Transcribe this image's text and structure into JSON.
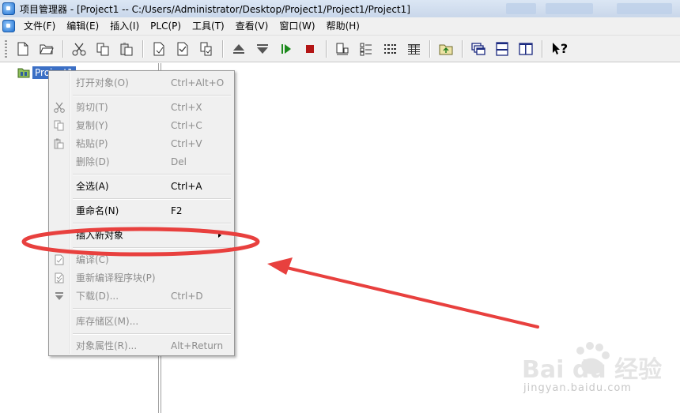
{
  "window": {
    "title": "项目管理器 - [Project1 -- C:/Users/Administrator/Desktop/Project1/Project1/Project1]"
  },
  "menubar": {
    "items": [
      "文件(F)",
      "编辑(E)",
      "插入(I)",
      "PLC(P)",
      "工具(T)",
      "查看(V)",
      "窗口(W)",
      "帮助(H)"
    ]
  },
  "toolbar": {
    "help_label": "?"
  },
  "tree": {
    "root_label": "Project1"
  },
  "context_menu": {
    "items": [
      {
        "label": "打开对象(O)",
        "shortcut": "Ctrl+Alt+O",
        "enabled": false
      },
      {
        "label": "剪切(T)",
        "shortcut": "Ctrl+X",
        "enabled": false,
        "icon": "scissors-icon"
      },
      {
        "label": "复制(Y)",
        "shortcut": "Ctrl+C",
        "enabled": false,
        "icon": "copy-icon"
      },
      {
        "label": "粘贴(P)",
        "shortcut": "Ctrl+V",
        "enabled": false,
        "icon": "paste-icon"
      },
      {
        "label": "删除(D)",
        "shortcut": "Del",
        "enabled": false
      },
      {
        "label": "全选(A)",
        "shortcut": "Ctrl+A",
        "enabled": true
      },
      {
        "label": "重命名(N)",
        "shortcut": "F2",
        "enabled": true
      },
      {
        "label": "插入新对象",
        "shortcut": "",
        "enabled": true,
        "submenu": true
      },
      {
        "label": "编译(C)",
        "shortcut": "",
        "enabled": false,
        "icon": "compile-icon"
      },
      {
        "label": "重新编译程序块(P)",
        "shortcut": "",
        "enabled": false,
        "icon": "recompile-icon"
      },
      {
        "label": "下载(D)...",
        "shortcut": "Ctrl+D",
        "enabled": false,
        "icon": "download-icon"
      },
      {
        "label": "库存储区(M)...",
        "shortcut": "",
        "enabled": false
      },
      {
        "label": "对象属性(R)...",
        "shortcut": "Alt+Return",
        "enabled": false
      }
    ]
  },
  "annotation": {
    "color": "#e8403e"
  },
  "watermark": {
    "text": "jingyan.baidu.com",
    "logo_text": "Bai du 经验"
  }
}
